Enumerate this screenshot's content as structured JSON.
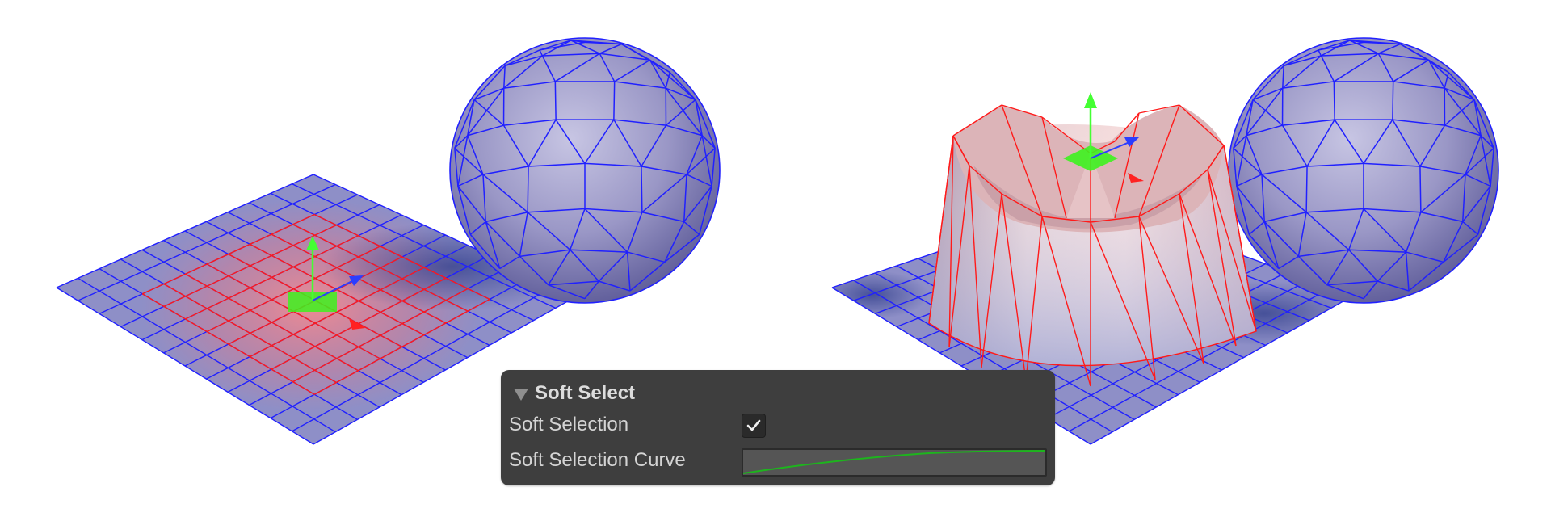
{
  "viewport": {
    "mesh_wire_color": "#2020ff",
    "selection_wire_color": "#ff1a1a",
    "gizmo_y_color": "#44ff33",
    "gizmo_x_color": "#ff2222",
    "gizmo_z_color": "#2b3dff"
  },
  "panel": {
    "title": "Soft Select",
    "foldout_icon": "triangle-down-icon",
    "rows": [
      {
        "label": "Soft Selection",
        "control": "checkbox",
        "checked": true
      },
      {
        "label": "Soft Selection Curve",
        "control": "curve-field"
      }
    ],
    "curve_color": "#1db51d"
  }
}
